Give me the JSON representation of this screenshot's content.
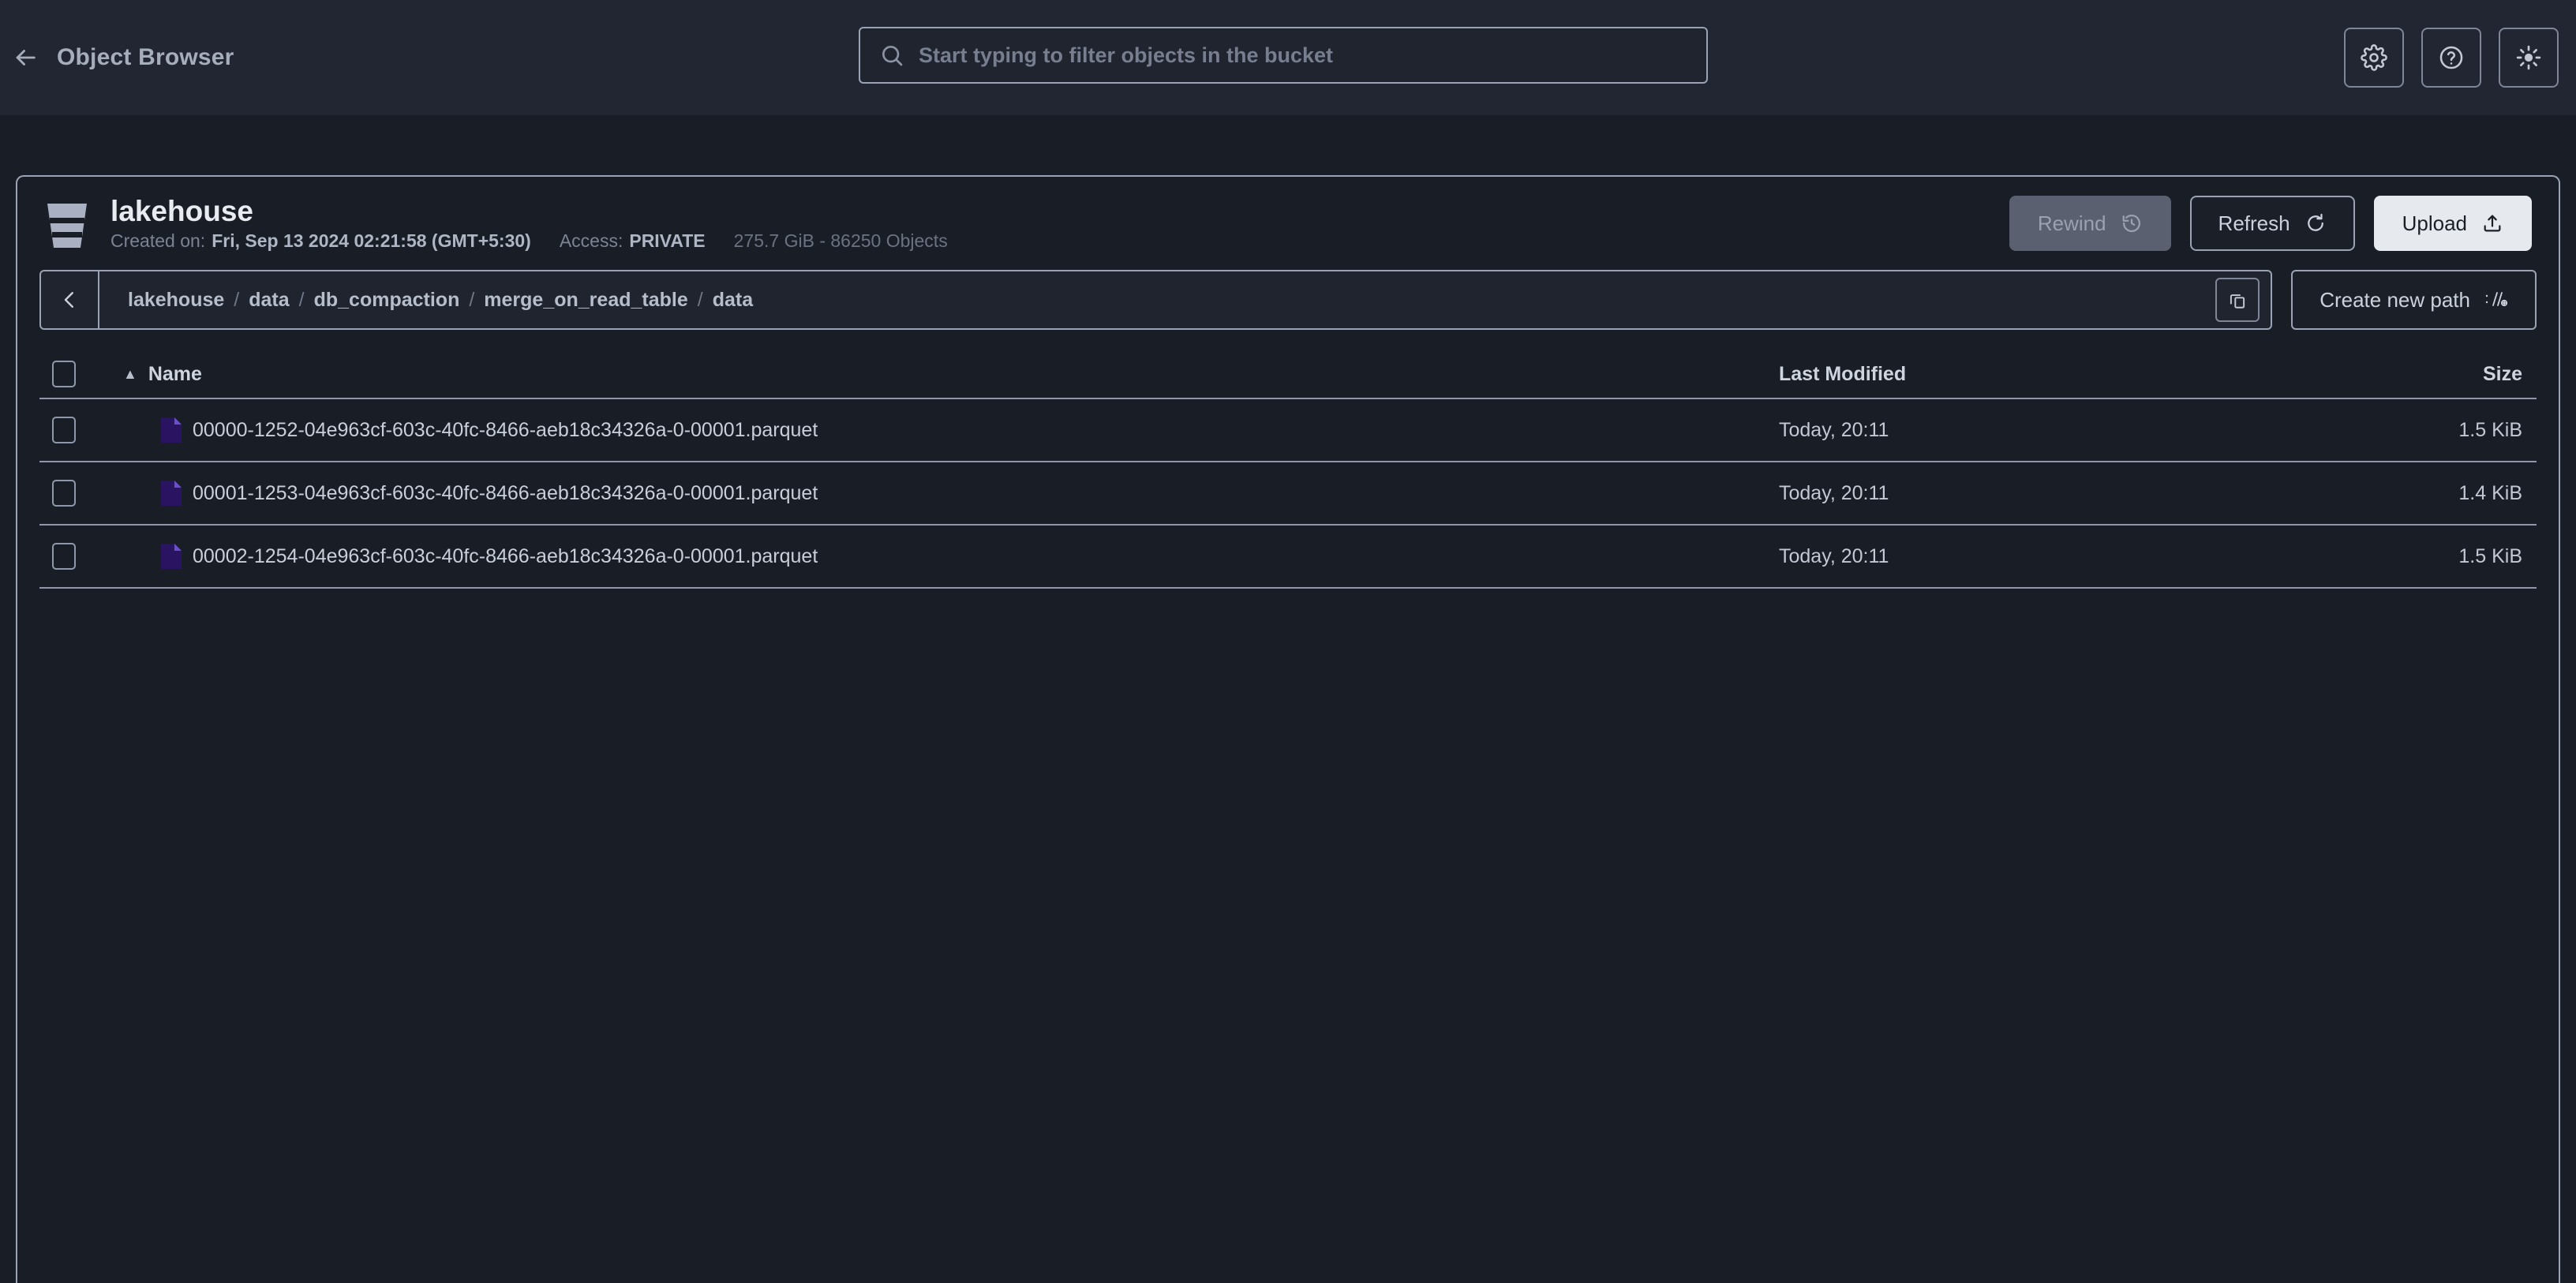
{
  "header": {
    "back_label": "Object Browser",
    "back_icon": "arrow-left-icon",
    "search": {
      "icon": "search-icon",
      "placeholder": "Start typing to filter objects in the bucket",
      "value": ""
    },
    "actions": [
      {
        "name": "settings-button",
        "icon": "gear-icon"
      },
      {
        "name": "help-button",
        "icon": "question-circle-icon"
      },
      {
        "name": "theme-toggle-button",
        "icon": "sun-icon"
      }
    ]
  },
  "bucket": {
    "icon": "bucket-icon",
    "name": "lakehouse",
    "created_label": "Created on:",
    "created_value": "Fri, Sep 13 2024 02:21:58 (GMT+5:30)",
    "access_label": "Access:",
    "access_value": "PRIVATE",
    "usage": "275.7 GiB - 86250 Objects",
    "buttons": {
      "rewind": {
        "label": "Rewind",
        "icon": "rewind-clock-icon",
        "disabled": true
      },
      "refresh": {
        "label": "Refresh",
        "icon": "refresh-icon",
        "disabled": false
      },
      "upload": {
        "label": "Upload",
        "icon": "upload-icon",
        "disabled": false
      }
    }
  },
  "breadcrumb": {
    "back_icon": "chevron-left-icon",
    "segments": [
      "lakehouse",
      "data",
      "db_compaction",
      "merge_on_read_table",
      "data"
    ],
    "separator": "/",
    "copy_icon": "copy-icon",
    "create_path": {
      "label": "Create new path",
      "icon": "new-path-icon"
    }
  },
  "table": {
    "select_all": {
      "name": "select-all-checkbox",
      "checked": false
    },
    "columns": {
      "name": "Name",
      "last_modified": "Last Modified",
      "size": "Size"
    },
    "sort": {
      "column": "Name",
      "direction": "asc",
      "caret": "▲"
    },
    "rows": [
      {
        "icon": "parquet-file-icon",
        "name": "00000-1252-04e963cf-603c-40fc-8466-aeb18c34326a-0-00001.parquet",
        "last_modified": "Today, 20:11",
        "size": "1.5 KiB",
        "checked": false
      },
      {
        "icon": "parquet-file-icon",
        "name": "00001-1253-04e963cf-603c-40fc-8466-aeb18c34326a-0-00001.parquet",
        "last_modified": "Today, 20:11",
        "size": "1.4 KiB",
        "checked": false
      },
      {
        "icon": "parquet-file-icon",
        "name": "00002-1254-04e963cf-603c-40fc-8466-aeb18c34326a-0-00001.parquet",
        "last_modified": "Today, 20:11",
        "size": "1.5 KiB",
        "checked": false
      }
    ]
  },
  "colors": {
    "page_bg": "#191d25",
    "topbar_bg": "#222633",
    "border": "#9aa3b5",
    "text_primary": "#e8ebf0",
    "text_muted": "#7b8395",
    "upload_bg": "#e6eaef",
    "rewind_bg": "#5b6071",
    "file_icon": "#2a1361",
    "file_icon_fold": "#6b4fd1"
  }
}
